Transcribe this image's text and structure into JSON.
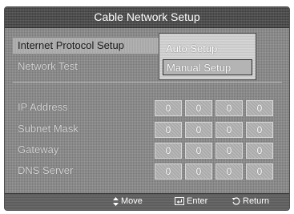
{
  "window": {
    "title": "Cable Network Setup"
  },
  "menu": {
    "items": [
      {
        "label": "Internet Protocol Setup"
      },
      {
        "label": "Network Test"
      }
    ]
  },
  "popup": {
    "options": [
      {
        "label": "Auto Setup"
      },
      {
        "label": "Manual Setup",
        "selected": true
      }
    ]
  },
  "fields": [
    {
      "label": "IP Address",
      "octets": [
        "0",
        "0",
        "0",
        "0"
      ]
    },
    {
      "label": "Subnet Mask",
      "octets": [
        "0",
        "0",
        "0",
        "0"
      ]
    },
    {
      "label": "Gateway",
      "octets": [
        "0",
        "0",
        "0",
        "0"
      ]
    },
    {
      "label": "DNS Server",
      "octets": [
        "0",
        "0",
        "0",
        "0"
      ]
    }
  ],
  "footer": {
    "move_label": "Move",
    "enter_label": "Enter",
    "return_label": "Return",
    "move_icon": "up-down-arrows-icon",
    "enter_icon": "enter-key-icon",
    "return_icon": "return-arrow-icon"
  }
}
